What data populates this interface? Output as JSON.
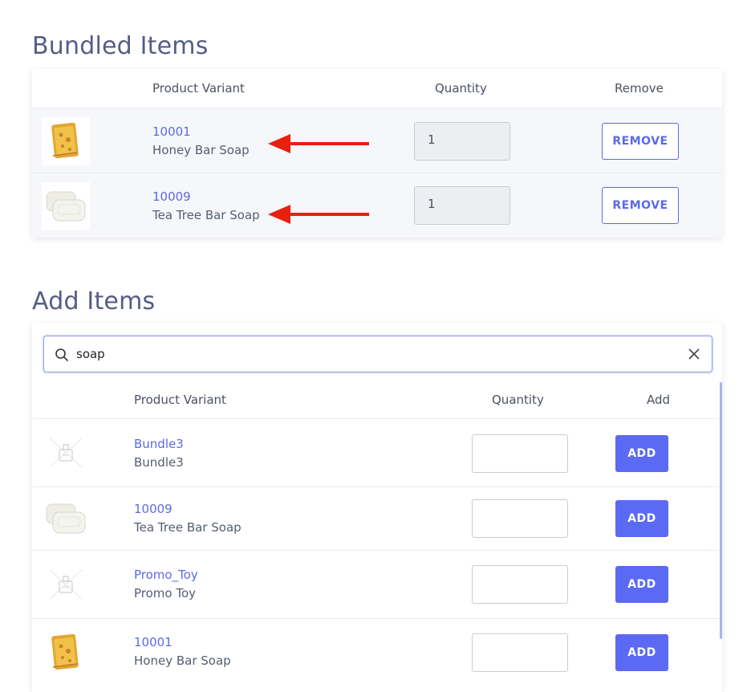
{
  "bundled": {
    "title": "Bundled Items",
    "columns": {
      "variant": "Product Variant",
      "quantity": "Quantity",
      "remove": "Remove"
    },
    "rows": [
      {
        "id": "10001",
        "name": "Honey Bar Soap",
        "quantity": "1",
        "remove_label": "REMOVE",
        "image": "honey-soap"
      },
      {
        "id": "10009",
        "name": "Tea Tree Bar Soap",
        "quantity": "1",
        "remove_label": "REMOVE",
        "image": "white-soap"
      }
    ]
  },
  "add_items": {
    "title": "Add Items",
    "search": {
      "value": "soap",
      "icon": "search-icon",
      "clear_icon": "close-icon"
    },
    "columns": {
      "variant": "Product Variant",
      "quantity": "Quantity",
      "add": "Add"
    },
    "rows": [
      {
        "id": "Bundle3",
        "name": "Bundle3",
        "quantity": "",
        "add_label": "ADD",
        "image": "placeholder"
      },
      {
        "id": "10009",
        "name": "Tea Tree Bar Soap",
        "quantity": "",
        "add_label": "ADD",
        "image": "white-soap"
      },
      {
        "id": "Promo_Toy",
        "name": "Promo Toy",
        "quantity": "",
        "add_label": "ADD",
        "image": "placeholder"
      },
      {
        "id": "10001",
        "name": "Honey Bar Soap",
        "quantity": "",
        "add_label": "ADD",
        "image": "honey-soap"
      }
    ]
  },
  "colors": {
    "accent": "#5b6af2",
    "heading": "#555d85",
    "annotation_arrow": "#e8200f"
  }
}
